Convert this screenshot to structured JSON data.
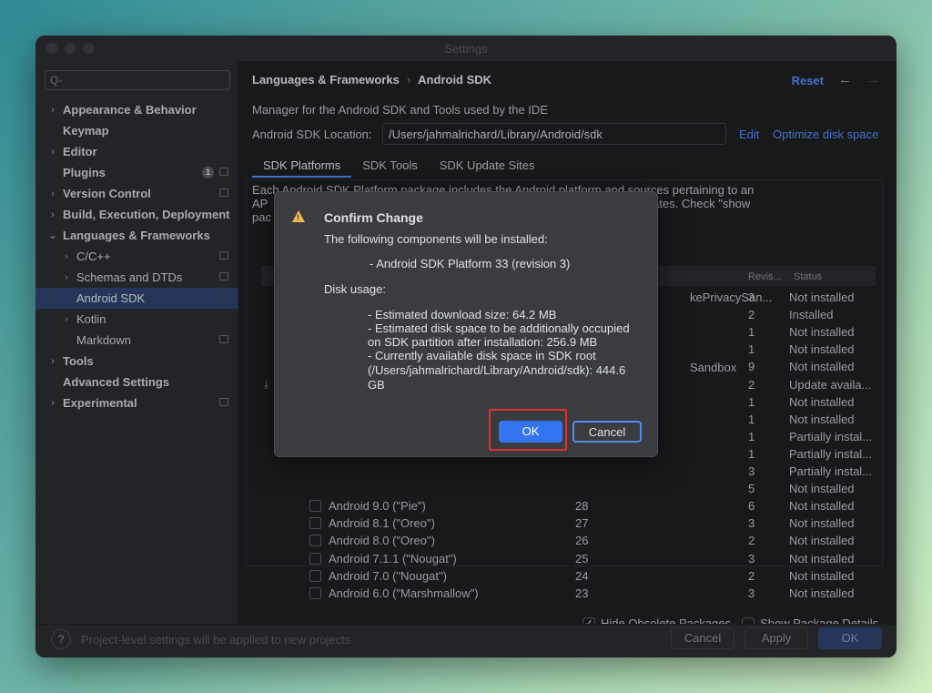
{
  "window": {
    "title": "Settings"
  },
  "sidebar": {
    "search_placeholder": "Q-",
    "items": [
      {
        "label": "Appearance & Behavior",
        "level": 0,
        "expandable": true,
        "bold": true
      },
      {
        "label": "Keymap",
        "level": 0,
        "expandable": false,
        "bold": true
      },
      {
        "label": "Editor",
        "level": 0,
        "expandable": true,
        "bold": true
      },
      {
        "label": "Plugins",
        "level": 0,
        "expandable": false,
        "bold": true,
        "badge": "1",
        "right_icon": true
      },
      {
        "label": "Version Control",
        "level": 0,
        "expandable": true,
        "bold": true,
        "right_icon": true
      },
      {
        "label": "Build, Execution, Deployment",
        "level": 0,
        "expandable": true,
        "bold": true
      },
      {
        "label": "Languages & Frameworks",
        "level": 0,
        "expandable": true,
        "expanded": true,
        "bold": true
      },
      {
        "label": "C/C++",
        "level": 1,
        "expandable": true,
        "right_icon": true
      },
      {
        "label": "Schemas and DTDs",
        "level": 1,
        "expandable": true,
        "right_icon": true
      },
      {
        "label": "Android SDK",
        "level": 1,
        "expandable": false,
        "selected": true
      },
      {
        "label": "Kotlin",
        "level": 1,
        "expandable": true
      },
      {
        "label": "Markdown",
        "level": 1,
        "expandable": false,
        "right_icon": true
      },
      {
        "label": "Tools",
        "level": 0,
        "expandable": true,
        "bold": true
      },
      {
        "label": "Advanced Settings",
        "level": 0,
        "expandable": false,
        "bold": true
      },
      {
        "label": "Experimental",
        "level": 0,
        "expandable": true,
        "bold": true,
        "right_icon": true
      }
    ]
  },
  "main": {
    "breadcrumb": [
      "Languages & Frameworks",
      "Android SDK"
    ],
    "reset_label": "Reset",
    "description": "Manager for the Android SDK and Tools used by the IDE",
    "location_label": "Android SDK Location:",
    "location_value": "/Users/jahmalrichard/Library/Android/sdk",
    "edit_label": "Edit",
    "optimize_label": "Optimize disk space",
    "tabs": [
      "SDK Platforms",
      "SDK Tools",
      "SDK Update Sites"
    ],
    "info_line1": "Each Android SDK Platform package includes the Android platform and sources pertaining to an",
    "info_line2_left": "AP",
    "info_line2_right": "ates. Check \"show",
    "info_line3_left": "pac",
    "table": {
      "rev_header": "Revis...",
      "status_header": "Status",
      "partial_names": [
        "kePrivacySan...",
        "Sandbox"
      ],
      "rows_top": [
        {
          "rev": "3",
          "status": "Not installed"
        },
        {
          "rev": "2",
          "status": "Installed"
        },
        {
          "rev": "1",
          "status": "Not installed"
        },
        {
          "rev": "1",
          "status": "Not installed"
        },
        {
          "rev": "9",
          "status": "Not installed"
        },
        {
          "rev": "2",
          "status": "Update availa..."
        },
        {
          "rev": "1",
          "status": "Not installed"
        },
        {
          "rev": "1",
          "status": "Not installed"
        },
        {
          "rev": "1",
          "status": "Partially instal..."
        },
        {
          "rev": "1",
          "status": "Partially instal..."
        },
        {
          "rev": "3",
          "status": "Partially instal..."
        },
        {
          "rev": "5",
          "status": "Not installed"
        }
      ],
      "rows_named": [
        {
          "name": "Android 9.0 (\"Pie\")",
          "api": "28",
          "rev": "6",
          "status": "Not installed"
        },
        {
          "name": "Android 8.1 (\"Oreo\")",
          "api": "27",
          "rev": "3",
          "status": "Not installed"
        },
        {
          "name": "Android 8.0 (\"Oreo\")",
          "api": "26",
          "rev": "2",
          "status": "Not installed"
        },
        {
          "name": "Android 7.1.1 (\"Nougat\")",
          "api": "25",
          "rev": "3",
          "status": "Not installed"
        },
        {
          "name": "Android 7.0 (\"Nougat\")",
          "api": "24",
          "rev": "2",
          "status": "Not installed"
        },
        {
          "name": "Android 6.0 (\"Marshmallow\")",
          "api": "23",
          "rev": "3",
          "status": "Not installed"
        }
      ]
    },
    "hide_obsolete_label": "Hide Obsolete Packages",
    "show_details_label": "Show Package Details"
  },
  "footer": {
    "help_label": "?",
    "note": "Project-level settings will be applied to new projects",
    "cancel_label": "Cancel",
    "apply_label": "Apply",
    "ok_label": "OK"
  },
  "dialog": {
    "title": "Confirm Change",
    "intro": "The following components will be installed:",
    "component": "- Android SDK Platform 33 (revision 3)",
    "disk_usage_label": "Disk usage:",
    "details": [
      "- Estimated download size: 64.2 MB",
      "- Estimated disk space to be additionally occupied",
      "on SDK partition after installation: 256.9 MB",
      "- Currently available disk space in SDK root",
      "(/Users/jahmalrichard/Library/Android/sdk): 444.6",
      "GB"
    ],
    "ok_label": "OK",
    "cancel_label": "Cancel"
  },
  "colors": {
    "accent": "#548af7",
    "primary_button": "#3574f0",
    "selection": "#2e436e",
    "warning": "#f2b84b",
    "highlight": "#e0302f"
  }
}
